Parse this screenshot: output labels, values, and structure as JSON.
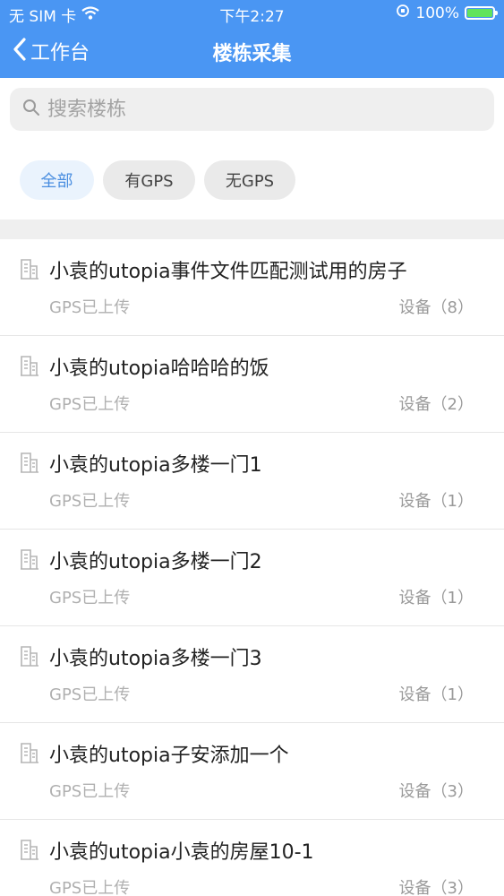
{
  "status_bar": {
    "carrier": "无 SIM 卡",
    "time": "下午2:27",
    "battery_percent": "100%"
  },
  "nav": {
    "back_label": "工作台",
    "title": "楼栋采集"
  },
  "search": {
    "placeholder": "搜索楼栋",
    "value": ""
  },
  "filters": [
    {
      "label": "全部",
      "active": true
    },
    {
      "label": "有GPS",
      "active": false
    },
    {
      "label": "无GPS",
      "active": false
    }
  ],
  "buildings": [
    {
      "name": "小袁的utopia事件文件匹配测试用的房子",
      "gps_status": "GPS已上传",
      "devices": "设备（8）"
    },
    {
      "name": "小袁的utopia哈哈哈的饭",
      "gps_status": "GPS已上传",
      "devices": "设备（2）"
    },
    {
      "name": "小袁的utopia多楼一门1",
      "gps_status": "GPS已上传",
      "devices": "设备（1）"
    },
    {
      "name": "小袁的utopia多楼一门2",
      "gps_status": "GPS已上传",
      "devices": "设备（1）"
    },
    {
      "name": "小袁的utopia多楼一门3",
      "gps_status": "GPS已上传",
      "devices": "设备（1）"
    },
    {
      "name": "小袁的utopia子安添加一个",
      "gps_status": "GPS已上传",
      "devices": "设备（3）"
    },
    {
      "name": "小袁的utopia小袁的房屋10-1",
      "gps_status": "GPS已上传",
      "devices": "设备（3）"
    }
  ],
  "colors": {
    "header": "#4a96f3",
    "chip_active_bg": "#eaf3fd",
    "chip_active_text": "#4a8ee0"
  }
}
